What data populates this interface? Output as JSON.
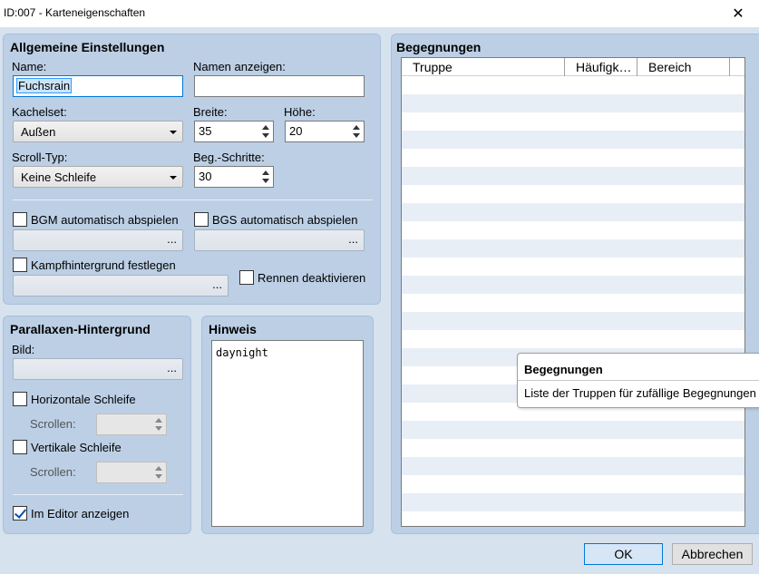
{
  "window": {
    "title": "ID:007 - Karteneigenschaften",
    "close_glyph": "✕"
  },
  "general": {
    "title": "Allgemeine Einstellungen",
    "name_label": "Name:",
    "name_value": "Fuchsrain",
    "display_name_label": "Namen anzeigen:",
    "display_name_value": "",
    "tileset_label": "Kachelset:",
    "tileset_value": "Außen",
    "width_label": "Breite:",
    "width_value": "35",
    "height_label": "Höhe:",
    "height_value": "20",
    "scroll_label": "Scroll-Typ:",
    "scroll_value": "Keine Schleife",
    "encounter_steps_label": "Beg.-Schritte:",
    "encounter_steps_value": "30",
    "bgm_label": "BGM automatisch abspielen",
    "bgs_label": "BGS automatisch abspielen",
    "battleback_label": "Kampfhintergrund festlegen",
    "disable_dash_label": "Rennen deaktivieren",
    "ellipsis": "..."
  },
  "parallax": {
    "title": "Parallaxen-Hintergrund",
    "image_label": "Bild:",
    "loop_h_label": "Horizontale Schleife",
    "scroll_label_h": "Scrollen:",
    "loop_v_label": "Vertikale Schleife",
    "scroll_label_v": "Scrollen:",
    "show_in_editor_label": "Im Editor anzeigen",
    "ellipsis": "..."
  },
  "note": {
    "title": "Hinweis",
    "text": "daynight"
  },
  "encounters": {
    "title": "Begegnungen",
    "columns": [
      "Truppe",
      "Häufigk…",
      "Bereich"
    ],
    "tooltip_title": "Begegnungen",
    "tooltip_text": "Liste der Truppen für zufällige Begegnungen"
  },
  "buttons": {
    "ok": "OK",
    "cancel": "Abbrechen"
  },
  "colors": {
    "panel": "#bccfe5",
    "background": "#d7e2ef",
    "accent": "#0078d7"
  }
}
